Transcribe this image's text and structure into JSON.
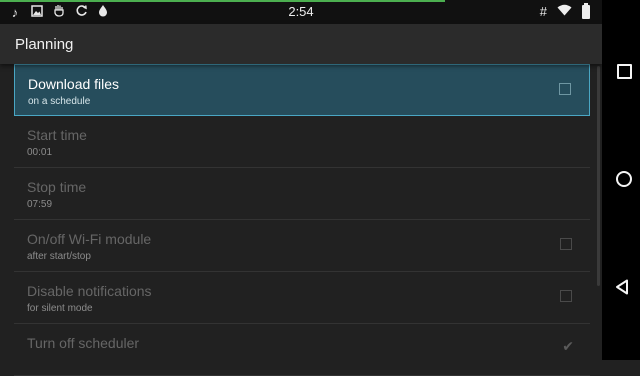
{
  "status_bar": {
    "time": "2:54",
    "progress": 0.74,
    "left_icons": [
      "music-note-icon",
      "image-icon",
      "gesture-icon",
      "sync-icon",
      "water-drop-icon"
    ],
    "right_icons": [
      "hash-icon",
      "wifi-icon",
      "battery-icon"
    ]
  },
  "action_bar": {
    "title": "Planning"
  },
  "settings": [
    {
      "title": "Download files",
      "subtitle": "on a schedule",
      "control": "checkbox",
      "checked": false,
      "enabled": true,
      "selected": true
    },
    {
      "title": "Start time",
      "subtitle": "00:01",
      "control": "none",
      "enabled": false
    },
    {
      "title": "Stop time",
      "subtitle": "07:59",
      "control": "none",
      "enabled": false
    },
    {
      "title": "On/off Wi-Fi module",
      "subtitle": "after start/stop",
      "control": "checkbox",
      "checked": false,
      "enabled": false
    },
    {
      "title": "Disable notifications",
      "subtitle": "for silent mode",
      "control": "checkbox",
      "checked": false,
      "enabled": false
    },
    {
      "title": "Turn off scheduler",
      "subtitle": "",
      "control": "checkbox",
      "checked": true,
      "enabled": false
    }
  ],
  "colors": {
    "accent_progress": "#4caf50",
    "selected_bg": "#264d5c",
    "selected_border": "#4aa7c4"
  }
}
